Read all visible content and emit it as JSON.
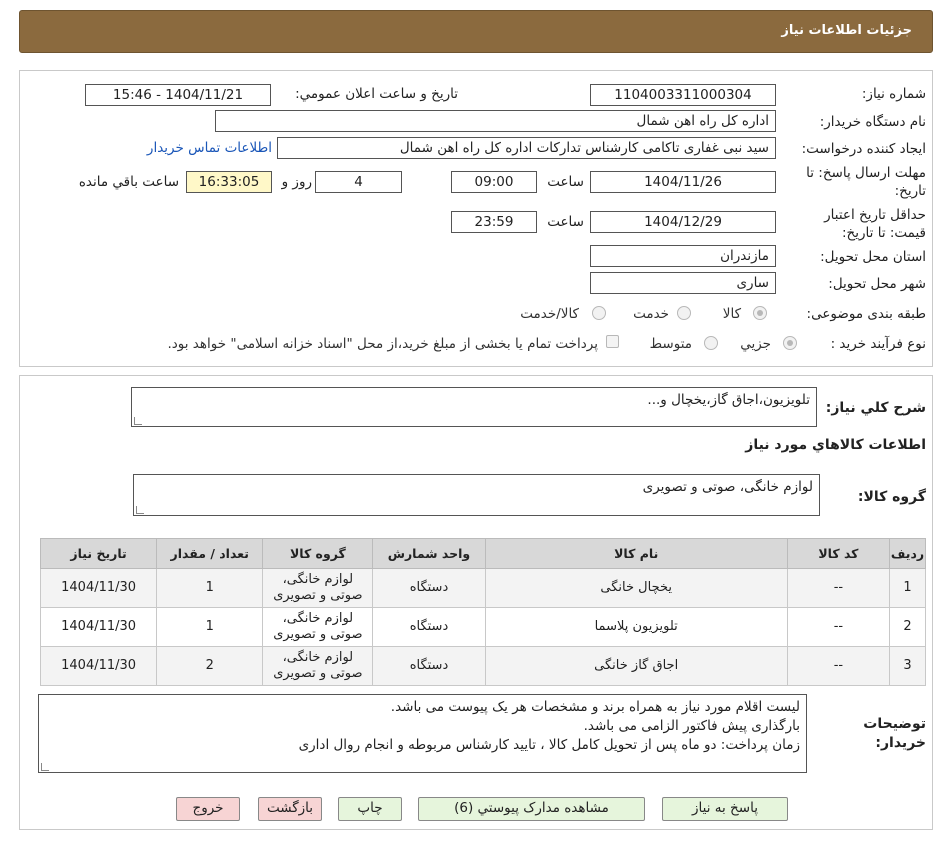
{
  "header": {
    "title": "جزئیات اطلاعات نیاز"
  },
  "watermark": {
    "text": "AriaTender.neT"
  },
  "form": {
    "need_number_label": "شماره نیاز:",
    "need_number": "1104003311000304",
    "announce_label": "تاریخ و ساعت اعلان عمومي:",
    "announce_value": "1404/11/21 - 15:46",
    "buyer_org_label": "نام دستگاه خریدار:",
    "buyer_org": "اداره کل راه اهن شمال",
    "creator_label": "ایجاد کننده درخواست:",
    "creator": "سید نبی غفاری تاکامی کارشناس تدارکات اداره کل راه اهن شمال",
    "contact_link": "اطلاعات تماس خریدار",
    "deadline_label_1": "مهلت ارسال پاسخ: تا",
    "deadline_label_2": "تاریخ:",
    "deadline_date": "1404/11/26",
    "time_label": "ساعت",
    "deadline_time": "09:00",
    "days_value": "4",
    "days_label": "روز و",
    "remaining_time": "16:33:05",
    "remaining_label": "ساعت باقي مانده",
    "validity_label_1": "حداقل تاریخ اعتبار",
    "validity_label_2": "قیمت: تا تاریخ:",
    "validity_date": "1404/12/29",
    "validity_time_label": "ساعت",
    "validity_time": "23:59",
    "province_label": "استان محل تحویل:",
    "province": "مازندران",
    "city_label": "شهر محل تحویل:",
    "city": "ساری",
    "category_label": "طبقه بندی موضوعی:",
    "category_options": [
      "کالا",
      "خدمت",
      "کالا/خدمت"
    ],
    "category_selected": "کالا",
    "process_label": "نوع فرآیند خرید :",
    "process_options": [
      "جزیي",
      "متوسط"
    ],
    "process_selected": "جزیي",
    "payment_note": "پرداخت تمام یا بخشی از مبلغ خرید،از محل \"اسناد خزانه اسلامی\" خواهد بود."
  },
  "details": {
    "summary_label": "شرح کلي نیاز:",
    "summary": "تلویزیون،اجاق گاز،یخچال و...",
    "goods_info_title": "اطلاعات کالاهاي مورد نیاز",
    "goods_group_label": "گروه کالا:",
    "goods_group": "لوازم خانگی، صوتی و تصویری",
    "table": {
      "headers": [
        "ردیف",
        "کد کالا",
        "نام کالا",
        "واحد شمارش",
        "گروه کالا",
        "تعداد / مقدار",
        "تاریخ نیاز"
      ],
      "rows": [
        {
          "row": "1",
          "code": "--",
          "name": "یخچال خانگی",
          "unit": "دستگاه",
          "group_1": "لوازم خانگی،",
          "group_2": "صوتی و تصویری",
          "qty": "1",
          "date": "1404/11/30"
        },
        {
          "row": "2",
          "code": "--",
          "name": "تلویزیون پلاسما",
          "unit": "دستگاه",
          "group_1": "لوازم خانگی،",
          "group_2": "صوتی و تصویری",
          "qty": "1",
          "date": "1404/11/30"
        },
        {
          "row": "3",
          "code": "--",
          "name": "اجاق گاز خانگی",
          "unit": "دستگاه",
          "group_1": "لوازم خانگی،",
          "group_2": "صوتی و تصویری",
          "qty": "2",
          "date": "1404/11/30"
        }
      ]
    },
    "buyer_notes_label_1": "توضیحات",
    "buyer_notes_label_2": "خریدار:",
    "buyer_notes": [
      "لیست اقلام مورد نیاز به همراه برند و مشخصات هر یک پیوست می باشد.",
      "بارگذاری پیش فاکتور الزامی می باشد.",
      "زمان پرداخت: دو ماه پس از تحویل کامل کالا ، تایید کارشناس مربوطه و انجام روال اداری"
    ]
  },
  "buttons": {
    "reply": "پاسخ به نیاز",
    "attachments": "مشاهده مدارک پیوستي (6)",
    "print": "چاپ",
    "back": "بازگشت",
    "exit": "خروج"
  }
}
